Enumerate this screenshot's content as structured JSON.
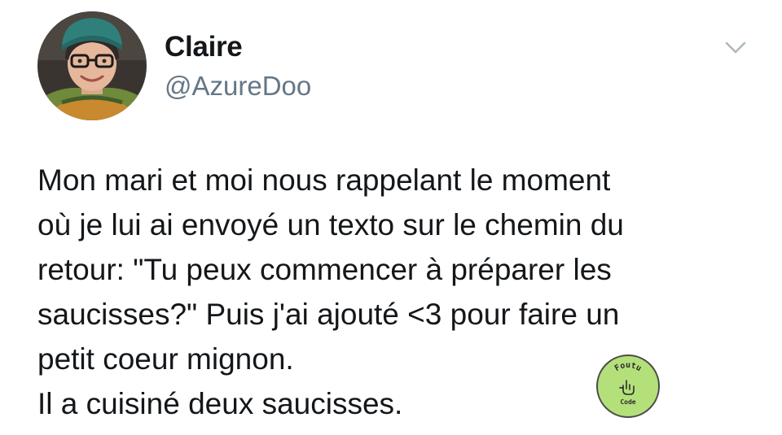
{
  "tweet": {
    "author": {
      "display_name": "Claire",
      "handle": "@AzureDoo"
    },
    "menu_icon": "chevron-down-icon",
    "text_lines": [
      "Mon mari et moi nous rappelant le moment",
      "où je lui ai envoyé un texto sur le chemin du",
      "retour: \"Tu peux commencer à préparer les",
      "saucisses?\" Puis j'ai ajouté <3 pour faire un",
      "petit coeur mignon.",
      "Il a cuisiné deux saucisses."
    ]
  },
  "watermark": {
    "top_text": "Foutu",
    "bottom_text": "Code",
    "color": "#b4e07a"
  },
  "colors": {
    "text": "#14171a",
    "secondary": "#657786",
    "caret": "#aab8c2"
  }
}
